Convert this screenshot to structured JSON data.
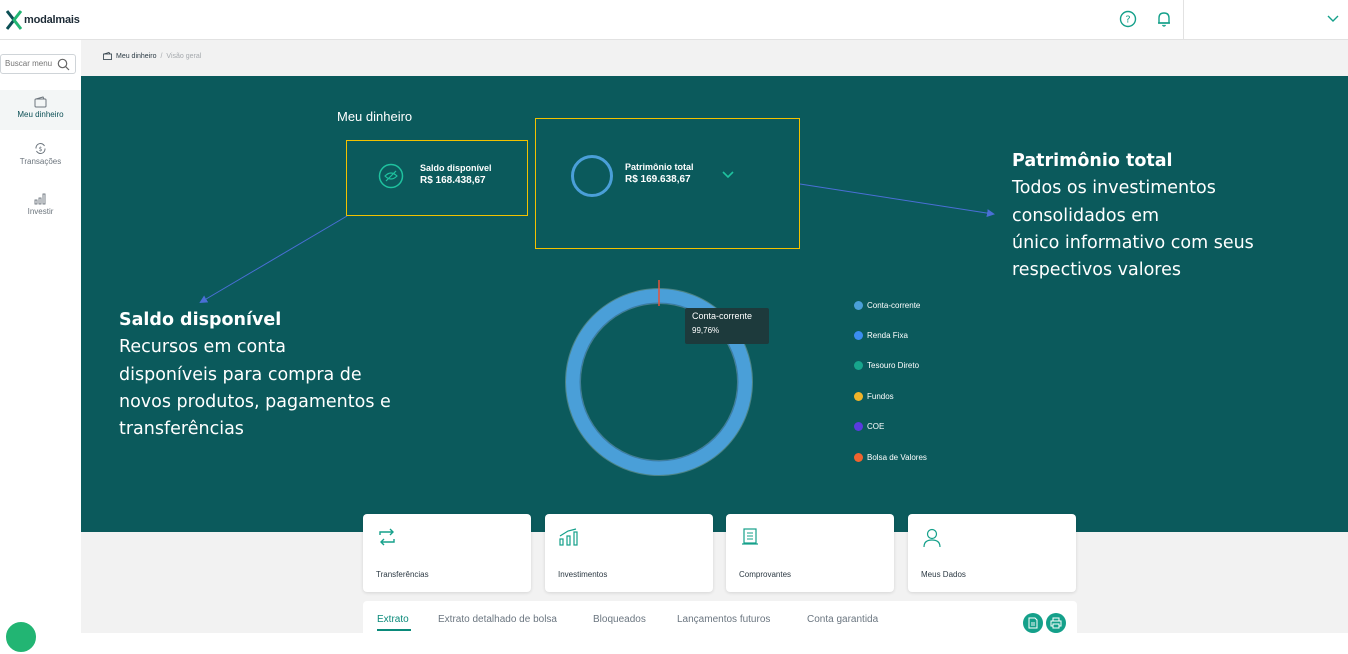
{
  "app": {
    "logo_text": "modalmais"
  },
  "sidebar": {
    "search_placeholder": "Buscar menu",
    "items": [
      {
        "label": "Meu dinheiro",
        "icon": "wallet-icon",
        "active": true
      },
      {
        "label": "Transações",
        "icon": "money-cycle-icon",
        "active": false
      },
      {
        "label": "Investir",
        "icon": "bar-chart-icon",
        "active": false
      }
    ]
  },
  "breadcrumb": {
    "root": "Meu dinheiro",
    "separator": "/",
    "current": "Visão geral"
  },
  "hero": {
    "title": "Meu dinheiro",
    "saldo": {
      "label": "Saldo disponível",
      "value": "R$ 168.438,67",
      "icon": "eye-off-icon"
    },
    "patrimonio": {
      "label": "Patrimônio total",
      "value": "R$ 169.638,67",
      "icon": "ring-icon"
    }
  },
  "donut": {
    "tooltip_label": "Conta-corrente",
    "tooltip_value": "99,76%"
  },
  "legend": [
    {
      "label": "Conta-corrente",
      "color": "#4a9fd8"
    },
    {
      "label": "Renda Fixa",
      "color": "#3b8df0"
    },
    {
      "label": "Tesouro Direto",
      "color": "#17a58c"
    },
    {
      "label": "Fundos",
      "color": "#f0b429"
    },
    {
      "label": "COE",
      "color": "#5a3be0"
    },
    {
      "label": "Bolsa de Valores",
      "color": "#f0632f"
    }
  ],
  "notes": {
    "patrimonio": {
      "title": "Patrimônio total",
      "lines": [
        "Todos os investimentos",
        "consolidados em",
        "único informativo com seus",
        "respectivos valores"
      ]
    },
    "saldo": {
      "title": "Saldo disponível",
      "lines": [
        "Recursos em conta",
        "disponíveis para compra de",
        "novos produtos, pagamentos e",
        "transferências"
      ]
    }
  },
  "actions": [
    {
      "label": "Transferências",
      "icon": "transfer-arrows-icon"
    },
    {
      "label": "Investimentos",
      "icon": "growth-chart-icon"
    },
    {
      "label": "Comprovantes",
      "icon": "receipt-icon"
    },
    {
      "label": "Meus Dados",
      "icon": "user-icon"
    }
  ],
  "tabs": [
    {
      "label": "Extrato",
      "active": true
    },
    {
      "label": "Extrato detalhado de bolsa",
      "active": false
    },
    {
      "label": "Bloqueados",
      "active": false
    },
    {
      "label": "Lançamentos futuros",
      "active": false
    },
    {
      "label": "Conta garantida",
      "active": false
    }
  ],
  "colors": {
    "hero_bg": "#0b5a5c",
    "accent": "#14a08a",
    "callout_border": "#f2c200",
    "annotation_arrow": "#4a6fd6"
  }
}
